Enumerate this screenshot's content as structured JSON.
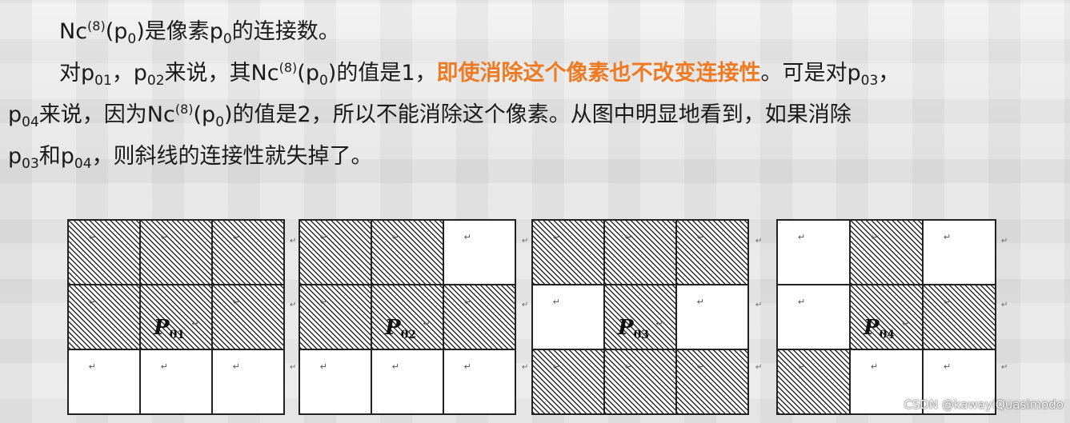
{
  "paragraph": {
    "line1": {
      "nc": "Nc",
      "sup": "(8)",
      "paren_open": "(p",
      "sub": "0",
      "rest": ")是像素p",
      "sub2": "0",
      "tail": "的连接数。"
    },
    "line2": {
      "a": "对p",
      "a_sub": "01",
      "b": "，p",
      "b_sub": "02",
      "c": "来说，其Nc",
      "c_sup": "(8)",
      "d": "(p",
      "d_sub": "0",
      "e": ")的值是1，",
      "highlight": "即使消除这个像素也不改变连接性",
      "f": "。可是对p",
      "f_sub": "03",
      "g": "，"
    },
    "line3": {
      "a": "p",
      "a_sub": "04",
      "b": "来说，因为Nc",
      "b_sup": "(8)",
      "c": "(p",
      "c_sub": "0",
      "d": ")的值是2，所以不能消除这个像素。从图中明显地看到，如果消除"
    },
    "line4": {
      "a": "p",
      "a_sub": "03",
      "b": "和p",
      "b_sub": "04",
      "c": "，则斜线的连接性就失掉了。"
    }
  },
  "grids": [
    {
      "label": "P",
      "label_sub": "01",
      "filled": [
        1,
        1,
        1,
        1,
        1,
        1,
        0,
        0,
        0
      ]
    },
    {
      "label": "P",
      "label_sub": "02",
      "filled": [
        1,
        1,
        0,
        1,
        1,
        1,
        0,
        0,
        0
      ]
    },
    {
      "label": "P",
      "label_sub": "03",
      "filled": [
        1,
        1,
        1,
        0,
        1,
        0,
        1,
        1,
        1
      ]
    },
    {
      "label": "P",
      "label_sub": "04",
      "filled": [
        0,
        1,
        0,
        0,
        1,
        1,
        1,
        0,
        0
      ]
    }
  ],
  "cell_mark": "↵",
  "separator_mark": "↵",
  "watermark": "CSDN @kawayiQuasimodo",
  "colors": {
    "highlight": "#ee7a24",
    "hatch": "#2b2b2b"
  }
}
